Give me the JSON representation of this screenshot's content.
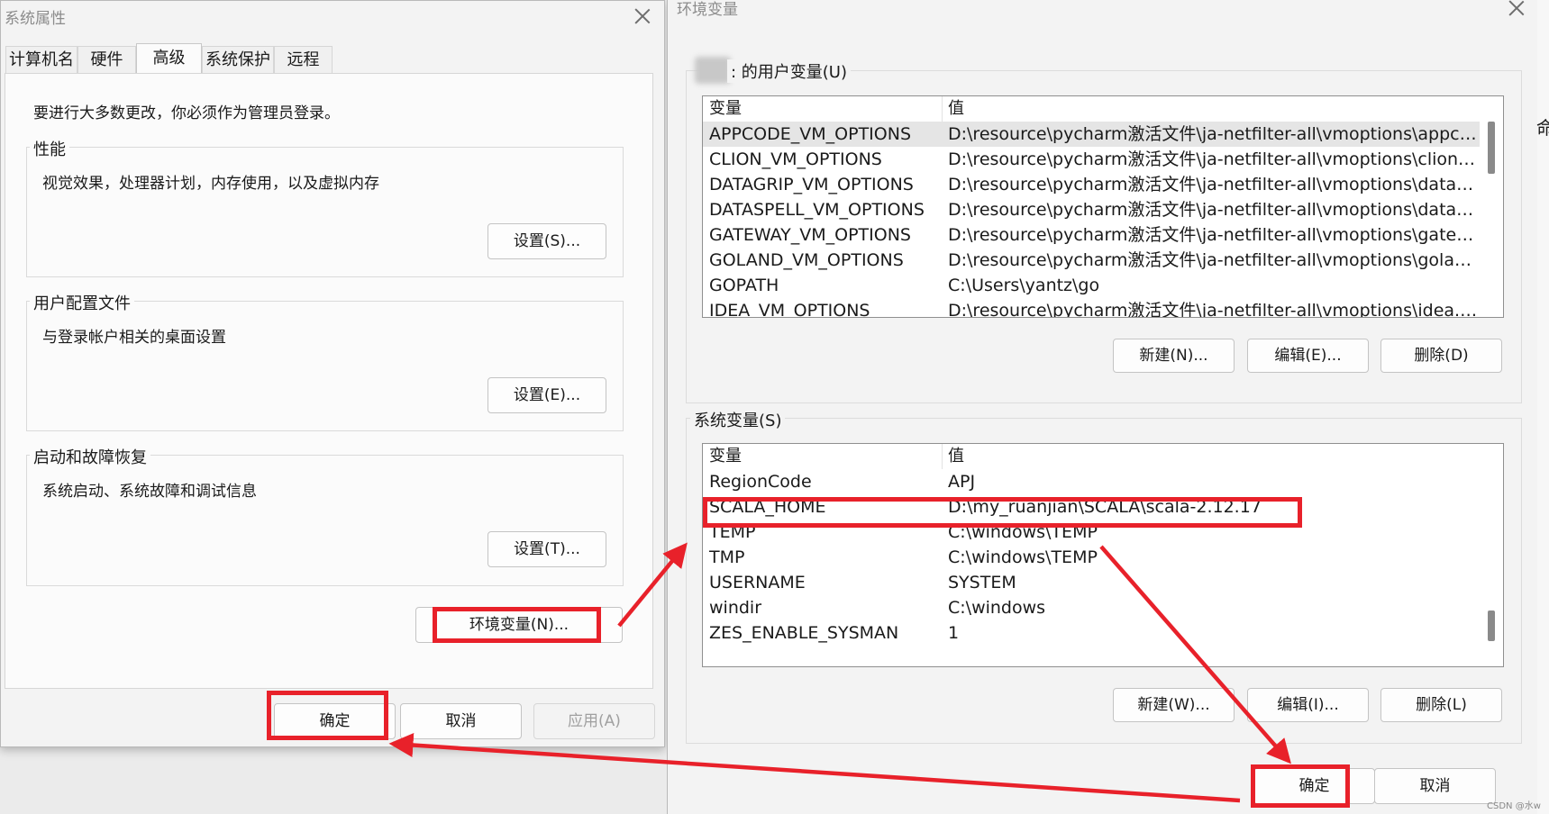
{
  "system_properties": {
    "title": "系统属性",
    "tabs": [
      {
        "label": "计算机名",
        "active": false
      },
      {
        "label": "硬件",
        "active": false
      },
      {
        "label": "高级",
        "active": true
      },
      {
        "label": "系统保护",
        "active": false
      },
      {
        "label": "远程",
        "active": false
      }
    ],
    "admin_note": "要进行大多数更改，你必须作为管理员登录。",
    "groups": [
      {
        "legend": "性能",
        "description": "视觉效果，处理器计划，内存使用，以及虚拟内存",
        "button": "设置(S)..."
      },
      {
        "legend": "用户配置文件",
        "description": "与登录帐户相关的桌面设置",
        "button": "设置(E)..."
      },
      {
        "legend": "启动和故障恢复",
        "description": "系统启动、系统故障和调试信息",
        "button": "设置(T)..."
      }
    ],
    "env_button": "环境变量(N)...",
    "ok": "确定",
    "cancel": "取消",
    "apply": "应用(A)"
  },
  "environment_variables": {
    "title": "环境变量",
    "user_section": {
      "label_suffix": ": 的用户变量(U)",
      "columns": [
        "变量",
        "值"
      ],
      "rows": [
        [
          "APPCODE_VM_OPTIONS",
          "D:\\resource\\pycharm激活文件\\ja-netfilter-all\\vmoptions\\appcode...."
        ],
        [
          "CLION_VM_OPTIONS",
          "D:\\resource\\pycharm激活文件\\ja-netfilter-all\\vmoptions\\clion.vmo..."
        ],
        [
          "DATAGRIP_VM_OPTIONS",
          "D:\\resource\\pycharm激活文件\\ja-netfilter-all\\vmoptions\\datagrip...."
        ],
        [
          "DATASPELL_VM_OPTIONS",
          "D:\\resource\\pycharm激活文件\\ja-netfilter-all\\vmoptions\\dataspell...."
        ],
        [
          "GATEWAY_VM_OPTIONS",
          "D:\\resource\\pycharm激活文件\\ja-netfilter-all\\vmoptions\\gateway.v..."
        ],
        [
          "GOLAND_VM_OPTIONS",
          "D:\\resource\\pycharm激活文件\\ja-netfilter-all\\vmoptions\\goland.v..."
        ],
        [
          "GOPATH",
          "C:\\Users\\yantz\\go"
        ],
        [
          "IDEA_VM_OPTIONS",
          "D:\\resource\\pycharm激活文件\\ja-netfilter-all\\vmoptions\\idea.vmo..."
        ]
      ],
      "buttons": {
        "new": "新建(N)...",
        "edit": "编辑(E)...",
        "delete": "删除(D)"
      }
    },
    "system_section": {
      "label": "系统变量(S)",
      "columns": [
        "变量",
        "值"
      ],
      "rows": [
        [
          "RegionCode",
          "APJ"
        ],
        [
          "SCALA_HOME",
          "D:\\my_ruanjian\\SCALA\\scala-2.12.17"
        ],
        [
          "TEMP",
          "C:\\windows\\TEMP"
        ],
        [
          "TMP",
          "C:\\windows\\TEMP"
        ],
        [
          "USERNAME",
          "SYSTEM"
        ],
        [
          "windir",
          "C:\\windows"
        ],
        [
          "ZES_ENABLE_SYSMAN",
          "1"
        ]
      ],
      "buttons": {
        "new": "新建(W)...",
        "edit": "编辑(I)...",
        "delete": "删除(L)"
      }
    },
    "ok": "确定",
    "cancel": "取消"
  },
  "annotation_color": "#e8212a",
  "watermark": "CSDN @水w",
  "edge_glyph": "命"
}
